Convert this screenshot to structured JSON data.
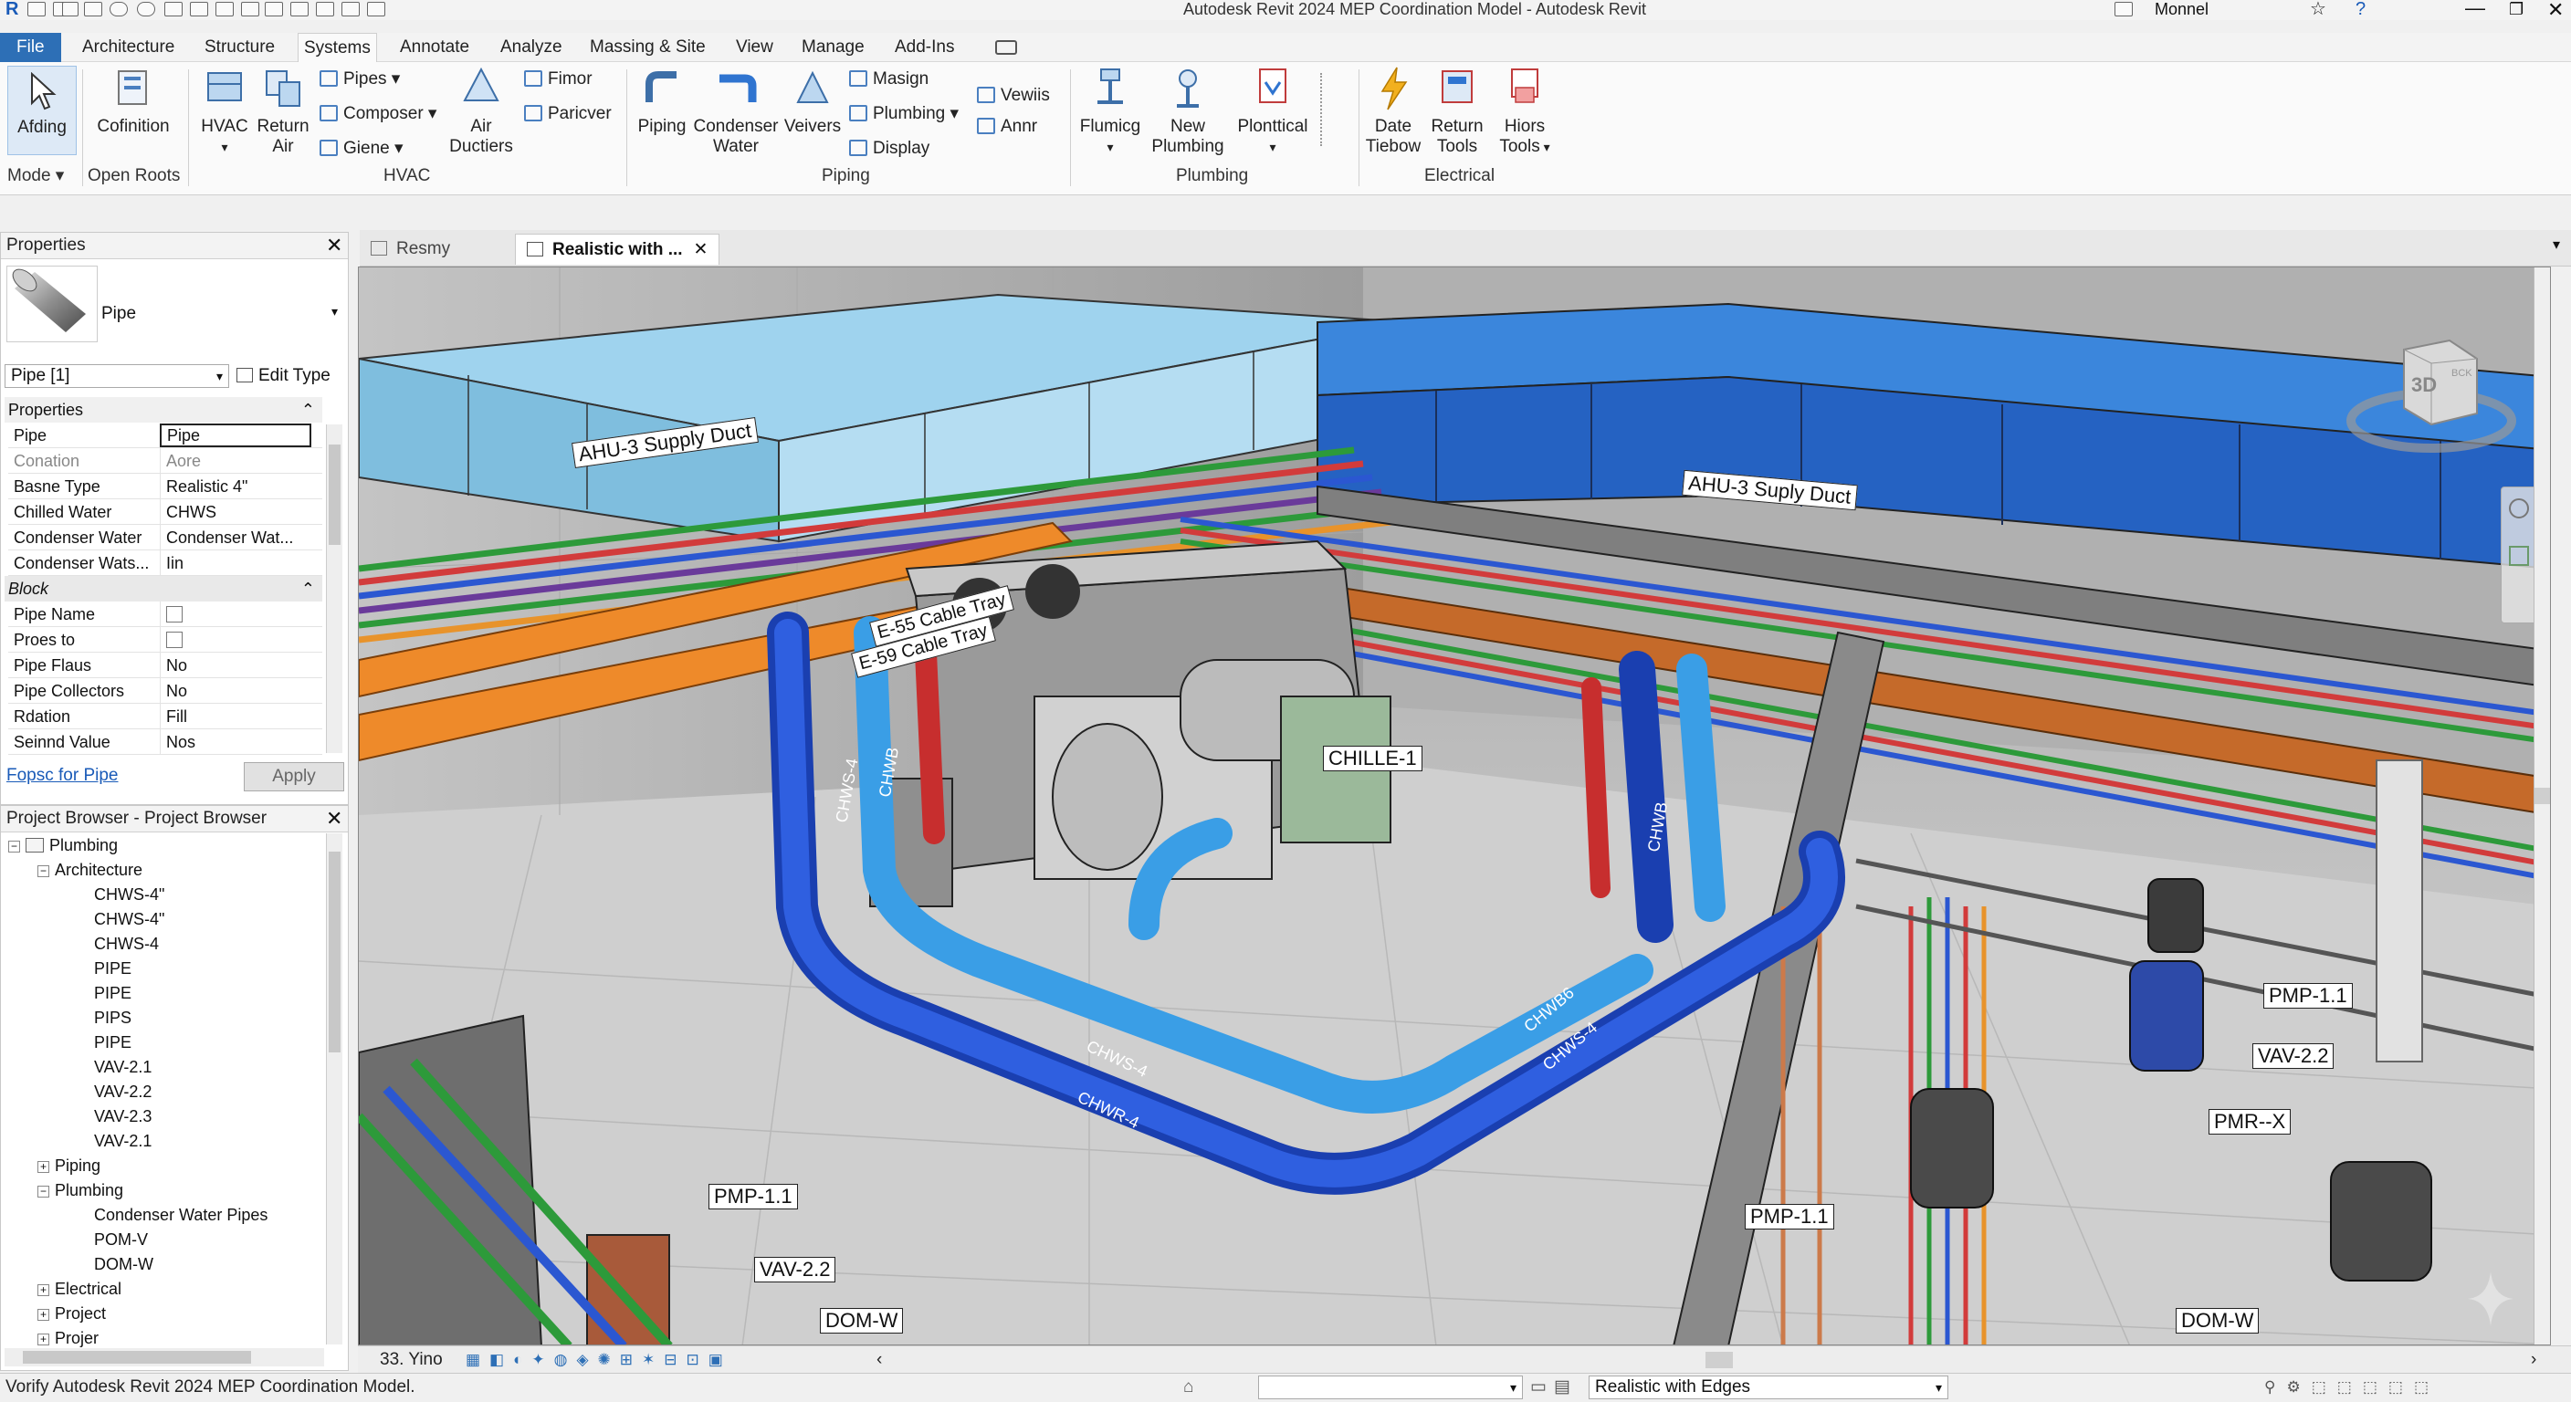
{
  "window": {
    "title": "Autodesk Revit 2024 MEP Coordination Model - Autodesk Revit",
    "user": "Monnel"
  },
  "colors": {
    "accent": "#2d6fb6",
    "supply_duct": "#2f74d0",
    "light_duct": "#8cc8e6",
    "cable_tray_orange": "#ee8a2a",
    "chws_blue": "#1c4fd1",
    "chwr_light": "#4aa8e8",
    "hot_red": "#d63030"
  },
  "ribbon": {
    "tabs": [
      "File",
      "Architecture",
      "Structure",
      "Systems",
      "Annotate",
      "Analyze",
      "Massing & Site",
      "View",
      "Manage",
      "Add-Ins"
    ],
    "active_tab": "Systems",
    "mode": {
      "btn": "Afding",
      "panel": "Mode"
    },
    "open_roots": {
      "btn": "Cofinition",
      "panel": "Open Roots"
    },
    "hvac": {
      "btn1": "HVAC",
      "btn2": "Return Air",
      "small": [
        "Pipes",
        "Composer",
        "Giene"
      ],
      "btn3": "Air Ductiers",
      "small2": [
        "Fimor",
        "Paricver"
      ],
      "panel": "HVAC"
    },
    "piping": {
      "btn1": "Piping",
      "btn2": "Condenser Water",
      "btn3": "Veivers",
      "small": [
        "Masign",
        "Plumbing",
        "Display"
      ],
      "small2": [
        "Vewiis",
        "Annr"
      ],
      "panel": "Piping"
    },
    "plumbing": {
      "btn1": "Flumicg",
      "btn2": "New Plumbing",
      "btn3": "Plonttical",
      "panel": "Plumbing"
    },
    "electrical": {
      "btn1": "Date Tiebow",
      "btn2": "Return Tools",
      "btn3": "Hiors Tools",
      "panel": "Electrical"
    }
  },
  "properties": {
    "title": "Properties",
    "type_name": "Pipe",
    "selector": "Pipe [1]",
    "edit_type": "Edit Type",
    "section1": "Properties",
    "rows": [
      [
        "Pipe",
        "Pipe"
      ],
      [
        "Conation",
        "Aore"
      ],
      [
        "Basne Type",
        "Realistic 4\""
      ],
      [
        "Chilled Water",
        "CHWS"
      ],
      [
        "Condenser Water",
        "Condenser Wat..."
      ],
      [
        "Condenser Wats...",
        "Iin"
      ]
    ],
    "section2": "Block",
    "rows2": [
      [
        "Pipe Name",
        ""
      ],
      [
        "Proes to",
        ""
      ],
      [
        "Pipe Flaus",
        "No"
      ],
      [
        "Pipe Collectors",
        "No"
      ],
      [
        "Rdation",
        "Fill"
      ],
      [
        "Seinnd Value",
        "Nos"
      ]
    ],
    "help_link": "Fopsc for Pipe",
    "apply": "Apply"
  },
  "browser": {
    "title": "Project Browser - Project Browser",
    "items": [
      "Plumbing",
      "Architecture",
      "CHWS-4\"",
      "CHWS-4\"",
      "CHWS-4",
      "PIPE",
      "PIPE",
      "PIPS",
      "PIPE",
      "VAV-2.1",
      "VAV-2.2",
      "VAV-2.3",
      "VAV-2.1",
      "Piping",
      "Plumbing",
      "Condenser Water Pipes",
      "POM-V",
      "DOM-W",
      "Electrical",
      "Project",
      "Projer"
    ]
  },
  "viewtabs": [
    "Resmy",
    "Realistic with ..."
  ],
  "viewcube": {
    "label": "3D",
    "side": "BCK"
  },
  "tags": {
    "duct1": "AHU-3 Supply Duct",
    "duct2": "AHU-3 Suply Duct",
    "tray1": "E-55 Cable Tray",
    "tray2": "E-59 Cable Tray",
    "chiller": "CHILLE-1",
    "chws1": "CHWS-4",
    "chwr1": "CHWR-4",
    "chwb1": "CHWB",
    "chwb2": "CHWB",
    "chwr2": "CHWR",
    "chws2": "CHWS-4",
    "chwb3": "CHWB6",
    "chws3": "CHWS-4",
    "pmp1": "PMP-1.1",
    "vav1": "VAV-2.2",
    "dom1": "DOM-W",
    "pmp2": "PMP-1.1",
    "vav2": "VAV-2.2",
    "pmrx": "PMR--X",
    "pmp3": "PMP-1.1",
    "dom2": "DOM-W"
  },
  "viewbar": {
    "scale": "33. Yino"
  },
  "status": {
    "message": "Vorify Autodesk Revit 2024 MEP Coordination Model.",
    "visual_style": "Realistic with Edges"
  }
}
